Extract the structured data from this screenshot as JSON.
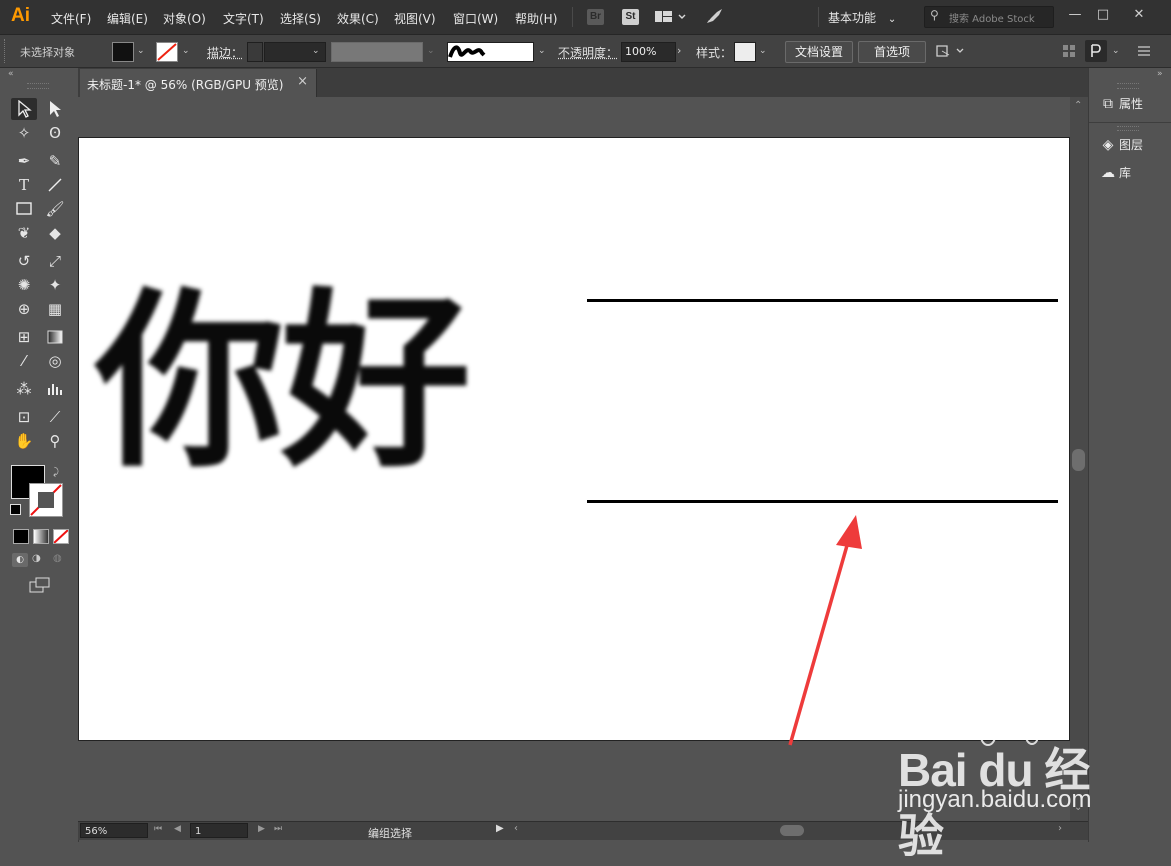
{
  "app": {
    "logo": "Ai",
    "accent": "#ff9a00"
  },
  "menu": [
    "文件(F)",
    "编辑(E)",
    "对象(O)",
    "文字(T)",
    "选择(S)",
    "效果(C)",
    "视图(V)",
    "窗口(W)",
    "帮助(H)"
  ],
  "menubar_icons": {
    "bridge": "Br",
    "stock": "St"
  },
  "workspace": {
    "label": "基本功能"
  },
  "search": {
    "placeholder": "搜索 Adobe Stock"
  },
  "window_controls": {
    "minimize": "—",
    "maximize": "□",
    "close": "✕"
  },
  "control_bar": {
    "selection": "未选择对象",
    "stroke_label": "描边：",
    "opacity_label": "不透明度：",
    "opacity_value": "100%",
    "style_label": "样式：",
    "doc_setup": "文档设置",
    "preferences": "首选项"
  },
  "document_tab": {
    "title": "未标题-1* @ 56% (RGB/GPU 预览)",
    "close": "×"
  },
  "artboard": {
    "text": "你好"
  },
  "status": {
    "zoom": "56%",
    "page": "1",
    "tool_label": "编组选择"
  },
  "right_panel": [
    {
      "icon": "properties-icon",
      "label": "属性"
    },
    {
      "icon": "layers-icon",
      "label": "图层"
    },
    {
      "icon": "libraries-icon",
      "label": "库"
    }
  ],
  "watermark": {
    "brand": "Bai du 经验",
    "url": "jingyan.baidu.com"
  }
}
